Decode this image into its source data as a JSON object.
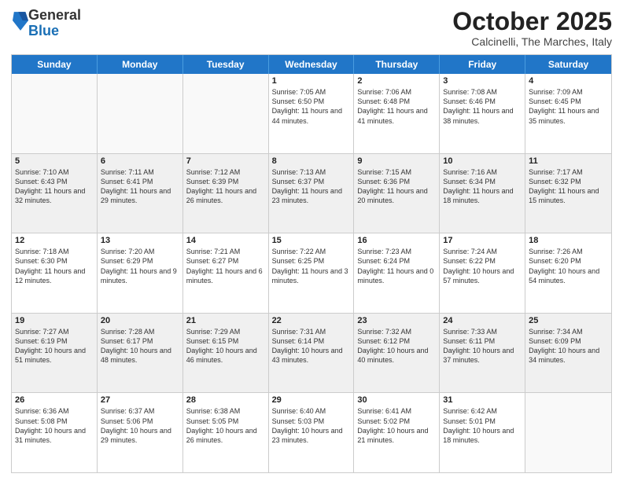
{
  "logo": {
    "general": "General",
    "blue": "Blue"
  },
  "title": "October 2025",
  "location": "Calcinelli, The Marches, Italy",
  "days": [
    "Sunday",
    "Monday",
    "Tuesday",
    "Wednesday",
    "Thursday",
    "Friday",
    "Saturday"
  ],
  "weeks": [
    [
      {
        "day": "",
        "info": ""
      },
      {
        "day": "",
        "info": ""
      },
      {
        "day": "",
        "info": ""
      },
      {
        "day": "1",
        "info": "Sunrise: 7:05 AM\nSunset: 6:50 PM\nDaylight: 11 hours and 44 minutes."
      },
      {
        "day": "2",
        "info": "Sunrise: 7:06 AM\nSunset: 6:48 PM\nDaylight: 11 hours and 41 minutes."
      },
      {
        "day": "3",
        "info": "Sunrise: 7:08 AM\nSunset: 6:46 PM\nDaylight: 11 hours and 38 minutes."
      },
      {
        "day": "4",
        "info": "Sunrise: 7:09 AM\nSunset: 6:45 PM\nDaylight: 11 hours and 35 minutes."
      }
    ],
    [
      {
        "day": "5",
        "info": "Sunrise: 7:10 AM\nSunset: 6:43 PM\nDaylight: 11 hours and 32 minutes."
      },
      {
        "day": "6",
        "info": "Sunrise: 7:11 AM\nSunset: 6:41 PM\nDaylight: 11 hours and 29 minutes."
      },
      {
        "day": "7",
        "info": "Sunrise: 7:12 AM\nSunset: 6:39 PM\nDaylight: 11 hours and 26 minutes."
      },
      {
        "day": "8",
        "info": "Sunrise: 7:13 AM\nSunset: 6:37 PM\nDaylight: 11 hours and 23 minutes."
      },
      {
        "day": "9",
        "info": "Sunrise: 7:15 AM\nSunset: 6:36 PM\nDaylight: 11 hours and 20 minutes."
      },
      {
        "day": "10",
        "info": "Sunrise: 7:16 AM\nSunset: 6:34 PM\nDaylight: 11 hours and 18 minutes."
      },
      {
        "day": "11",
        "info": "Sunrise: 7:17 AM\nSunset: 6:32 PM\nDaylight: 11 hours and 15 minutes."
      }
    ],
    [
      {
        "day": "12",
        "info": "Sunrise: 7:18 AM\nSunset: 6:30 PM\nDaylight: 11 hours and 12 minutes."
      },
      {
        "day": "13",
        "info": "Sunrise: 7:20 AM\nSunset: 6:29 PM\nDaylight: 11 hours and 9 minutes."
      },
      {
        "day": "14",
        "info": "Sunrise: 7:21 AM\nSunset: 6:27 PM\nDaylight: 11 hours and 6 minutes."
      },
      {
        "day": "15",
        "info": "Sunrise: 7:22 AM\nSunset: 6:25 PM\nDaylight: 11 hours and 3 minutes."
      },
      {
        "day": "16",
        "info": "Sunrise: 7:23 AM\nSunset: 6:24 PM\nDaylight: 11 hours and 0 minutes."
      },
      {
        "day": "17",
        "info": "Sunrise: 7:24 AM\nSunset: 6:22 PM\nDaylight: 10 hours and 57 minutes."
      },
      {
        "day": "18",
        "info": "Sunrise: 7:26 AM\nSunset: 6:20 PM\nDaylight: 10 hours and 54 minutes."
      }
    ],
    [
      {
        "day": "19",
        "info": "Sunrise: 7:27 AM\nSunset: 6:19 PM\nDaylight: 10 hours and 51 minutes."
      },
      {
        "day": "20",
        "info": "Sunrise: 7:28 AM\nSunset: 6:17 PM\nDaylight: 10 hours and 48 minutes."
      },
      {
        "day": "21",
        "info": "Sunrise: 7:29 AM\nSunset: 6:15 PM\nDaylight: 10 hours and 46 minutes."
      },
      {
        "day": "22",
        "info": "Sunrise: 7:31 AM\nSunset: 6:14 PM\nDaylight: 10 hours and 43 minutes."
      },
      {
        "day": "23",
        "info": "Sunrise: 7:32 AM\nSunset: 6:12 PM\nDaylight: 10 hours and 40 minutes."
      },
      {
        "day": "24",
        "info": "Sunrise: 7:33 AM\nSunset: 6:11 PM\nDaylight: 10 hours and 37 minutes."
      },
      {
        "day": "25",
        "info": "Sunrise: 7:34 AM\nSunset: 6:09 PM\nDaylight: 10 hours and 34 minutes."
      }
    ],
    [
      {
        "day": "26",
        "info": "Sunrise: 6:36 AM\nSunset: 5:08 PM\nDaylight: 10 hours and 31 minutes."
      },
      {
        "day": "27",
        "info": "Sunrise: 6:37 AM\nSunset: 5:06 PM\nDaylight: 10 hours and 29 minutes."
      },
      {
        "day": "28",
        "info": "Sunrise: 6:38 AM\nSunset: 5:05 PM\nDaylight: 10 hours and 26 minutes."
      },
      {
        "day": "29",
        "info": "Sunrise: 6:40 AM\nSunset: 5:03 PM\nDaylight: 10 hours and 23 minutes."
      },
      {
        "day": "30",
        "info": "Sunrise: 6:41 AM\nSunset: 5:02 PM\nDaylight: 10 hours and 21 minutes."
      },
      {
        "day": "31",
        "info": "Sunrise: 6:42 AM\nSunset: 5:01 PM\nDaylight: 10 hours and 18 minutes."
      },
      {
        "day": "",
        "info": ""
      }
    ]
  ]
}
